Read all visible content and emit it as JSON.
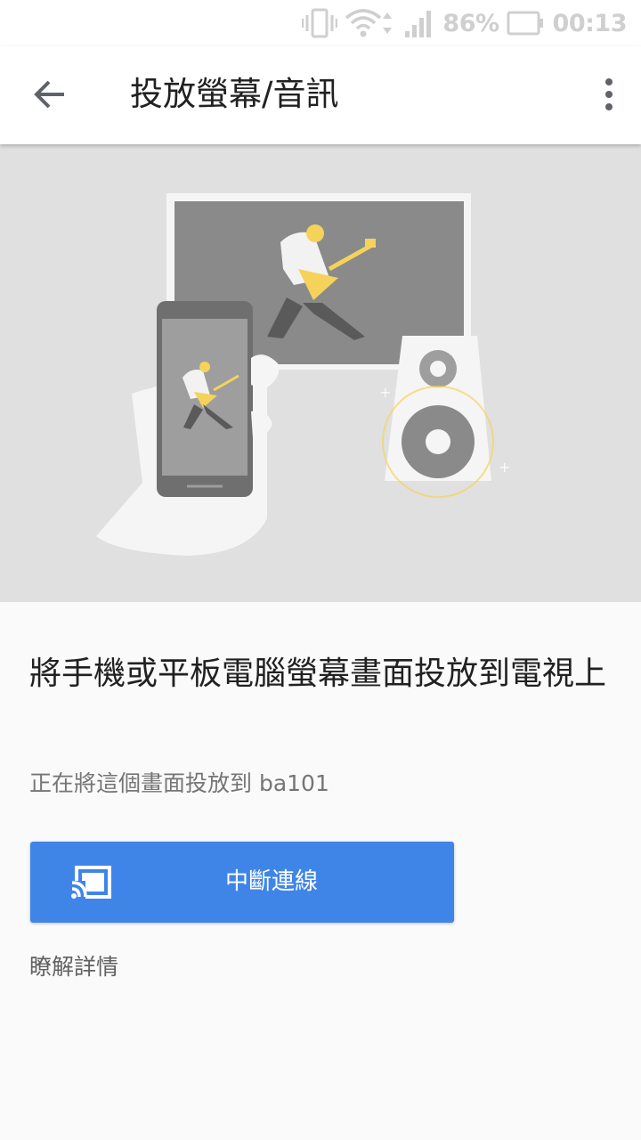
{
  "status_bar": {
    "battery_percent": "86%",
    "time": "00:13",
    "icons": [
      "vibrate-icon",
      "wifi-icon",
      "signal-icon",
      "battery-icon"
    ]
  },
  "app_bar": {
    "title": "投放螢幕/音訊",
    "back_icon": "arrow-back-icon",
    "more_icon": "more-vert-icon"
  },
  "main": {
    "headline": "將手機或平板電腦螢幕畫面投放到電視上",
    "subtitle": "正在將這個畫面投放到 ba101",
    "disconnect_label": "中斷連線",
    "disconnect_icon": "cast-connected-icon",
    "learn_more": "瞭解詳情"
  },
  "colors": {
    "primary_button": "#3f85e8",
    "hero_background": "#e0e0e0",
    "accent_yellow": "#f5d35a"
  }
}
